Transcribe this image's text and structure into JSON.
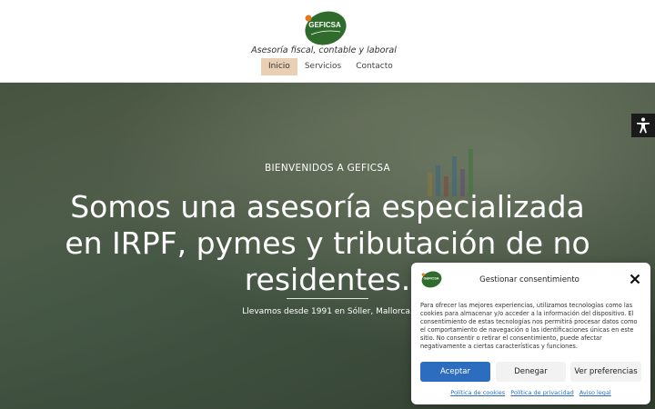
{
  "header": {
    "logo_text": "GEFICSA",
    "tagline": "Asesoría fiscal, contable y laboral",
    "nav": [
      {
        "label": "Inicio",
        "active": true
      },
      {
        "label": "Servicios",
        "active": false
      },
      {
        "label": "Contacto",
        "active": false
      }
    ]
  },
  "hero": {
    "pretitle": "BIENVENIDOS A GEFICSA",
    "title": "Somos una asesoría especializada en IRPF, pymes y tributación de no residentes.",
    "subtitle": "Llevamos desde 1991 en Sóller, Mallorca."
  },
  "accessibility": {
    "icon": "accessibility-icon"
  },
  "cookie_banner": {
    "logo_text": "GEFICSA",
    "title": "Gestionar consentimiento",
    "text": "Para ofrecer las mejores experiencias, utilizamos tecnologías como las cookies para almacenar y/o acceder a la información del dispositivo. El consentimiento de estas tecnologías nos permitirá procesar datos como el comportamiento de navegación o las identificaciones únicas en este sitio. No consentir o retirar el consentimiento, puede afectar negativamente a ciertas características y funciones.",
    "accept_label": "Aceptar",
    "deny_label": "Denegar",
    "prefs_label": "Ver preferencias",
    "links": [
      "Política de cookies",
      "Política de privacidad",
      "Aviso legal"
    ]
  },
  "colors": {
    "accent": "#2c6dbf",
    "nav_active_bg": "#e9d0b5",
    "logo_green": "#2f6b2a"
  }
}
